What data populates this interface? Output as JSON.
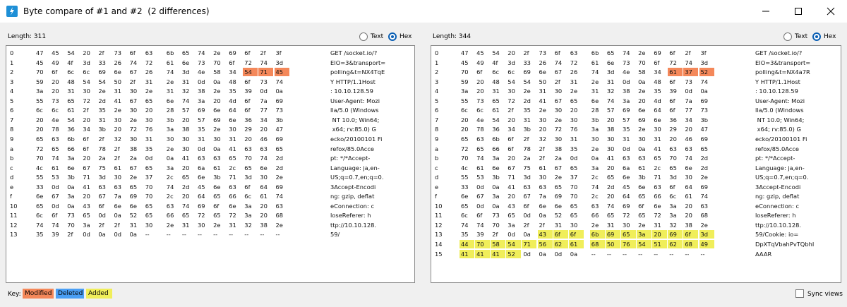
{
  "window": {
    "title": "Byte compare of #1 and #2  (2 differences)"
  },
  "left": {
    "length_label": "Length: 311",
    "radio_text": "Text",
    "radio_hex": "Hex",
    "rows": [
      {
        "off": "0",
        "bytes": [
          "47",
          "45",
          "54",
          "20",
          "2f",
          "73",
          "6f",
          "63",
          "6b",
          "65",
          "74",
          "2e",
          "69",
          "6f",
          "2f",
          "3f"
        ],
        "text": "GET /socket.io/?",
        "mod": [],
        "add": []
      },
      {
        "off": "1",
        "bytes": [
          "45",
          "49",
          "4f",
          "3d",
          "33",
          "26",
          "74",
          "72",
          "61",
          "6e",
          "73",
          "70",
          "6f",
          "72",
          "74",
          "3d"
        ],
        "text": "EIO=3&transport=",
        "mod": [],
        "add": []
      },
      {
        "off": "2",
        "bytes": [
          "70",
          "6f",
          "6c",
          "6c",
          "69",
          "6e",
          "67",
          "26",
          "74",
          "3d",
          "4e",
          "58",
          "34",
          "54",
          "71",
          "45"
        ],
        "text": "polling&t=NX4TqE",
        "mod": [
          13,
          14,
          15
        ],
        "add": []
      },
      {
        "off": "3",
        "bytes": [
          "59",
          "20",
          "48",
          "54",
          "54",
          "50",
          "2f",
          "31",
          "2e",
          "31",
          "0d",
          "0a",
          "48",
          "6f",
          "73",
          "74"
        ],
        "text": "Y HTTP/1.1Host",
        "mod": [],
        "add": []
      },
      {
        "off": "4",
        "bytes": [
          "3a",
          "20",
          "31",
          "30",
          "2e",
          "31",
          "30",
          "2e",
          "31",
          "32",
          "38",
          "2e",
          "35",
          "39",
          "0d",
          "0a"
        ],
        "text": ": 10.10.128.59",
        "mod": [],
        "add": []
      },
      {
        "off": "5",
        "bytes": [
          "55",
          "73",
          "65",
          "72",
          "2d",
          "41",
          "67",
          "65",
          "6e",
          "74",
          "3a",
          "20",
          "4d",
          "6f",
          "7a",
          "69"
        ],
        "text": "User-Agent: Mozi",
        "mod": [],
        "add": []
      },
      {
        "off": "6",
        "bytes": [
          "6c",
          "6c",
          "61",
          "2f",
          "35",
          "2e",
          "30",
          "20",
          "28",
          "57",
          "69",
          "6e",
          "64",
          "6f",
          "77",
          "73"
        ],
        "text": "lla/5.0 (Windows",
        "mod": [],
        "add": []
      },
      {
        "off": "7",
        "bytes": [
          "20",
          "4e",
          "54",
          "20",
          "31",
          "30",
          "2e",
          "30",
          "3b",
          "20",
          "57",
          "69",
          "6e",
          "36",
          "34",
          "3b"
        ],
        "text": " NT 10.0; Win64;",
        "mod": [],
        "add": []
      },
      {
        "off": "8",
        "bytes": [
          "20",
          "78",
          "36",
          "34",
          "3b",
          "20",
          "72",
          "76",
          "3a",
          "38",
          "35",
          "2e",
          "30",
          "29",
          "20",
          "47"
        ],
        "text": " x64; rv:85.0) G",
        "mod": [],
        "add": []
      },
      {
        "off": "9",
        "bytes": [
          "65",
          "63",
          "6b",
          "6f",
          "2f",
          "32",
          "30",
          "31",
          "30",
          "30",
          "31",
          "30",
          "31",
          "20",
          "46",
          "69"
        ],
        "text": "ecko/20100101 Fi",
        "mod": [],
        "add": []
      },
      {
        "off": "a",
        "bytes": [
          "72",
          "65",
          "66",
          "6f",
          "78",
          "2f",
          "38",
          "35",
          "2e",
          "30",
          "0d",
          "0a",
          "41",
          "63",
          "63",
          "65"
        ],
        "text": "refox/85.0Acce",
        "mod": [],
        "add": []
      },
      {
        "off": "b",
        "bytes": [
          "70",
          "74",
          "3a",
          "20",
          "2a",
          "2f",
          "2a",
          "0d",
          "0a",
          "41",
          "63",
          "63",
          "65",
          "70",
          "74",
          "2d"
        ],
        "text": "pt: */*Accept-",
        "mod": [],
        "add": []
      },
      {
        "off": "c",
        "bytes": [
          "4c",
          "61",
          "6e",
          "67",
          "75",
          "61",
          "67",
          "65",
          "3a",
          "20",
          "6a",
          "61",
          "2c",
          "65",
          "6e",
          "2d"
        ],
        "text": "Language: ja,en-",
        "mod": [],
        "add": []
      },
      {
        "off": "d",
        "bytes": [
          "55",
          "53",
          "3b",
          "71",
          "3d",
          "30",
          "2e",
          "37",
          "2c",
          "65",
          "6e",
          "3b",
          "71",
          "3d",
          "30",
          "2e"
        ],
        "text": "US;q=0.7,en;q=0.",
        "mod": [],
        "add": []
      },
      {
        "off": "e",
        "bytes": [
          "33",
          "0d",
          "0a",
          "41",
          "63",
          "63",
          "65",
          "70",
          "74",
          "2d",
          "45",
          "6e",
          "63",
          "6f",
          "64",
          "69"
        ],
        "text": "3Accept-Encodi",
        "mod": [],
        "add": []
      },
      {
        "off": "f",
        "bytes": [
          "6e",
          "67",
          "3a",
          "20",
          "67",
          "7a",
          "69",
          "70",
          "2c",
          "20",
          "64",
          "65",
          "66",
          "6c",
          "61",
          "74"
        ],
        "text": "ng: gzip, deflat",
        "mod": [],
        "add": []
      },
      {
        "off": "10",
        "bytes": [
          "65",
          "0d",
          "0a",
          "43",
          "6f",
          "6e",
          "6e",
          "65",
          "63",
          "74",
          "69",
          "6f",
          "6e",
          "3a",
          "20",
          "63"
        ],
        "text": "eConnection: c",
        "mod": [],
        "add": []
      },
      {
        "off": "11",
        "bytes": [
          "6c",
          "6f",
          "73",
          "65",
          "0d",
          "0a",
          "52",
          "65",
          "66",
          "65",
          "72",
          "65",
          "72",
          "3a",
          "20",
          "68"
        ],
        "text": "loseReferer: h",
        "mod": [],
        "add": []
      },
      {
        "off": "12",
        "bytes": [
          "74",
          "74",
          "70",
          "3a",
          "2f",
          "2f",
          "31",
          "30",
          "2e",
          "31",
          "30",
          "2e",
          "31",
          "32",
          "38",
          "2e"
        ],
        "text": "ttp://10.10.128.",
        "mod": [],
        "add": []
      },
      {
        "off": "13",
        "bytes": [
          "35",
          "39",
          "2f",
          "0d",
          "0a",
          "0d",
          "0a",
          "--",
          "--",
          "--",
          "--",
          "--",
          "--",
          "--",
          "--",
          "--"
        ],
        "text": "59/",
        "mod": [],
        "add": []
      }
    ]
  },
  "right": {
    "length_label": "Length: 344",
    "radio_text": "Text",
    "radio_hex": "Hex",
    "rows": [
      {
        "off": "0",
        "bytes": [
          "47",
          "45",
          "54",
          "20",
          "2f",
          "73",
          "6f",
          "63",
          "6b",
          "65",
          "74",
          "2e",
          "69",
          "6f",
          "2f",
          "3f"
        ],
        "text": "GET /socket.io/?",
        "mod": [],
        "add": []
      },
      {
        "off": "1",
        "bytes": [
          "45",
          "49",
          "4f",
          "3d",
          "33",
          "26",
          "74",
          "72",
          "61",
          "6e",
          "73",
          "70",
          "6f",
          "72",
          "74",
          "3d"
        ],
        "text": "EIO=3&transport=",
        "mod": [],
        "add": []
      },
      {
        "off": "2",
        "bytes": [
          "70",
          "6f",
          "6c",
          "6c",
          "69",
          "6e",
          "67",
          "26",
          "74",
          "3d",
          "4e",
          "58",
          "34",
          "61",
          "37",
          "52"
        ],
        "text": "polling&t=NX4a7R",
        "mod": [
          13,
          14,
          15
        ],
        "add": []
      },
      {
        "off": "3",
        "bytes": [
          "59",
          "20",
          "48",
          "54",
          "54",
          "50",
          "2f",
          "31",
          "2e",
          "31",
          "0d",
          "0a",
          "48",
          "6f",
          "73",
          "74"
        ],
        "text": "Y HTTP/1.1Host",
        "mod": [],
        "add": []
      },
      {
        "off": "4",
        "bytes": [
          "3a",
          "20",
          "31",
          "30",
          "2e",
          "31",
          "30",
          "2e",
          "31",
          "32",
          "38",
          "2e",
          "35",
          "39",
          "0d",
          "0a"
        ],
        "text": ": 10.10.128.59",
        "mod": [],
        "add": []
      },
      {
        "off": "5",
        "bytes": [
          "55",
          "73",
          "65",
          "72",
          "2d",
          "41",
          "67",
          "65",
          "6e",
          "74",
          "3a",
          "20",
          "4d",
          "6f",
          "7a",
          "69"
        ],
        "text": "User-Agent: Mozi",
        "mod": [],
        "add": []
      },
      {
        "off": "6",
        "bytes": [
          "6c",
          "6c",
          "61",
          "2f",
          "35",
          "2e",
          "30",
          "20",
          "28",
          "57",
          "69",
          "6e",
          "64",
          "6f",
          "77",
          "73"
        ],
        "text": "lla/5.0 (Windows",
        "mod": [],
        "add": []
      },
      {
        "off": "7",
        "bytes": [
          "20",
          "4e",
          "54",
          "20",
          "31",
          "30",
          "2e",
          "30",
          "3b",
          "20",
          "57",
          "69",
          "6e",
          "36",
          "34",
          "3b"
        ],
        "text": " NT 10.0; Win64;",
        "mod": [],
        "add": []
      },
      {
        "off": "8",
        "bytes": [
          "20",
          "78",
          "36",
          "34",
          "3b",
          "20",
          "72",
          "76",
          "3a",
          "38",
          "35",
          "2e",
          "30",
          "29",
          "20",
          "47"
        ],
        "text": " x64; rv:85.0) G",
        "mod": [],
        "add": []
      },
      {
        "off": "9",
        "bytes": [
          "65",
          "63",
          "6b",
          "6f",
          "2f",
          "32",
          "30",
          "31",
          "30",
          "30",
          "31",
          "30",
          "31",
          "20",
          "46",
          "69"
        ],
        "text": "ecko/20100101 Fi",
        "mod": [],
        "add": []
      },
      {
        "off": "a",
        "bytes": [
          "72",
          "65",
          "66",
          "6f",
          "78",
          "2f",
          "38",
          "35",
          "2e",
          "30",
          "0d",
          "0a",
          "41",
          "63",
          "63",
          "65"
        ],
        "text": "refox/85.0Acce",
        "mod": [],
        "add": []
      },
      {
        "off": "b",
        "bytes": [
          "70",
          "74",
          "3a",
          "20",
          "2a",
          "2f",
          "2a",
          "0d",
          "0a",
          "41",
          "63",
          "63",
          "65",
          "70",
          "74",
          "2d"
        ],
        "text": "pt: */*Accept-",
        "mod": [],
        "add": []
      },
      {
        "off": "c",
        "bytes": [
          "4c",
          "61",
          "6e",
          "67",
          "75",
          "61",
          "67",
          "65",
          "3a",
          "20",
          "6a",
          "61",
          "2c",
          "65",
          "6e",
          "2d"
        ],
        "text": "Language: ja,en-",
        "mod": [],
        "add": []
      },
      {
        "off": "d",
        "bytes": [
          "55",
          "53",
          "3b",
          "71",
          "3d",
          "30",
          "2e",
          "37",
          "2c",
          "65",
          "6e",
          "3b",
          "71",
          "3d",
          "30",
          "2e"
        ],
        "text": "US;q=0.7,en;q=0.",
        "mod": [],
        "add": []
      },
      {
        "off": "e",
        "bytes": [
          "33",
          "0d",
          "0a",
          "41",
          "63",
          "63",
          "65",
          "70",
          "74",
          "2d",
          "45",
          "6e",
          "63",
          "6f",
          "64",
          "69"
        ],
        "text": "3Accept-Encodi",
        "mod": [],
        "add": []
      },
      {
        "off": "f",
        "bytes": [
          "6e",
          "67",
          "3a",
          "20",
          "67",
          "7a",
          "69",
          "70",
          "2c",
          "20",
          "64",
          "65",
          "66",
          "6c",
          "61",
          "74"
        ],
        "text": "ng: gzip, deflat",
        "mod": [],
        "add": []
      },
      {
        "off": "10",
        "bytes": [
          "65",
          "0d",
          "0a",
          "43",
          "6f",
          "6e",
          "6e",
          "65",
          "63",
          "74",
          "69",
          "6f",
          "6e",
          "3a",
          "20",
          "63"
        ],
        "text": "eConnection: c",
        "mod": [],
        "add": []
      },
      {
        "off": "11",
        "bytes": [
          "6c",
          "6f",
          "73",
          "65",
          "0d",
          "0a",
          "52",
          "65",
          "66",
          "65",
          "72",
          "65",
          "72",
          "3a",
          "20",
          "68"
        ],
        "text": "loseReferer: h",
        "mod": [],
        "add": []
      },
      {
        "off": "12",
        "bytes": [
          "74",
          "74",
          "70",
          "3a",
          "2f",
          "2f",
          "31",
          "30",
          "2e",
          "31",
          "30",
          "2e",
          "31",
          "32",
          "38",
          "2e"
        ],
        "text": "ttp://10.10.128.",
        "mod": [],
        "add": []
      },
      {
        "off": "13",
        "bytes": [
          "35",
          "39",
          "2f",
          "0d",
          "0a",
          "43",
          "6f",
          "6f",
          "6b",
          "69",
          "65",
          "3a",
          "20",
          "69",
          "6f",
          "3d"
        ],
        "text": "59/Cookie: io=",
        "mod": [],
        "add": [
          5,
          6,
          7,
          8,
          9,
          10,
          11,
          12,
          13,
          14,
          15
        ]
      },
      {
        "off": "14",
        "bytes": [
          "44",
          "70",
          "58",
          "54",
          "71",
          "56",
          "62",
          "61",
          "68",
          "50",
          "76",
          "54",
          "51",
          "62",
          "68",
          "49"
        ],
        "text": "DpXTqVbahPvTQbhI",
        "mod": [],
        "add": [
          0,
          1,
          2,
          3,
          4,
          5,
          6,
          7,
          8,
          9,
          10,
          11,
          12,
          13,
          14,
          15
        ]
      },
      {
        "off": "15",
        "bytes": [
          "41",
          "41",
          "41",
          "52",
          "0d",
          "0a",
          "0d",
          "0a",
          "--",
          "--",
          "--",
          "--",
          "--",
          "--",
          "--",
          "--"
        ],
        "text": "AAAR",
        "mod": [],
        "add": [
          0,
          1,
          2,
          3
        ]
      }
    ]
  },
  "footer": {
    "key_label": "Key:",
    "modified_label": "Modified",
    "deleted_label": "Deleted",
    "added_label": "Added",
    "sync_label": "Sync views"
  },
  "colors": {
    "modified": "#f4885a",
    "deleted": "#4a9ff5",
    "added": "#f0ee5a",
    "accent": "#0a5fb4"
  }
}
